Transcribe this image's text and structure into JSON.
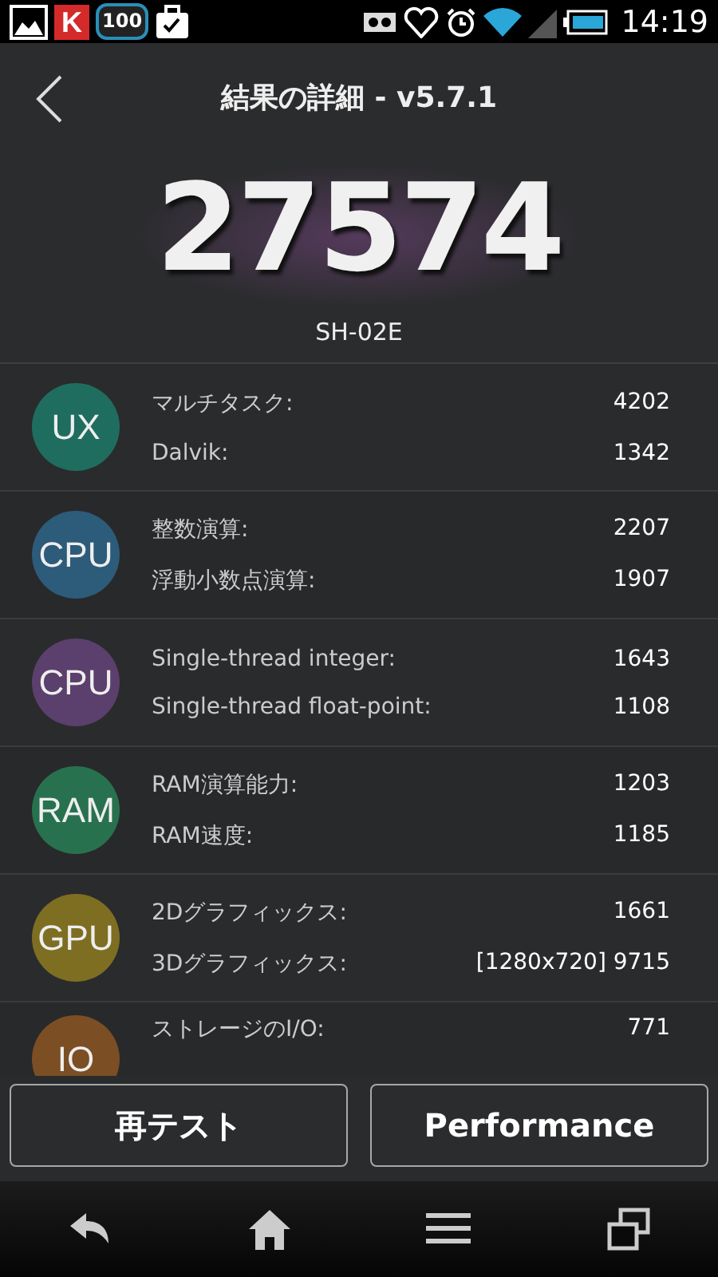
{
  "status_bar": {
    "badge": "100",
    "app_letter": "K",
    "time": "14:19"
  },
  "header": {
    "title": "結果の詳細 - v5.7.1",
    "score": "27574",
    "device": "SH-02E"
  },
  "groups": [
    {
      "label": "UX",
      "color": "#1f6d5e",
      "rows": [
        {
          "name": "マルチタスク:",
          "value": "4202"
        },
        {
          "name": "Dalvik:",
          "value": "1342"
        }
      ]
    },
    {
      "label": "CPU",
      "color": "#2d5b7a",
      "rows": [
        {
          "name": "整数演算:",
          "value": "2207"
        },
        {
          "name": "浮動小数点演算:",
          "value": "1907"
        }
      ]
    },
    {
      "label": "CPU",
      "color": "#5b3f6c",
      "rows": [
        {
          "name": "Single-thread integer:",
          "value": "1643"
        },
        {
          "name": "Single-thread float-point:",
          "value": "1108"
        }
      ]
    },
    {
      "label": "RAM",
      "color": "#28714f",
      "rows": [
        {
          "name": "RAM演算能力:",
          "value": "1203"
        },
        {
          "name": "RAM速度:",
          "value": "1185"
        }
      ]
    },
    {
      "label": "GPU",
      "color": "#7e6e22",
      "rows": [
        {
          "name": "2Dグラフィックス:",
          "value": "1661"
        },
        {
          "name": "3Dグラフィックス:",
          "value": "[1280x720] 9715"
        }
      ]
    },
    {
      "label": "IO",
      "color": "#7b4e24",
      "rows": [
        {
          "name": "ストレージのI/O:",
          "value": "771"
        }
      ]
    }
  ],
  "buttons": [
    "再テスト",
    "Performance"
  ]
}
